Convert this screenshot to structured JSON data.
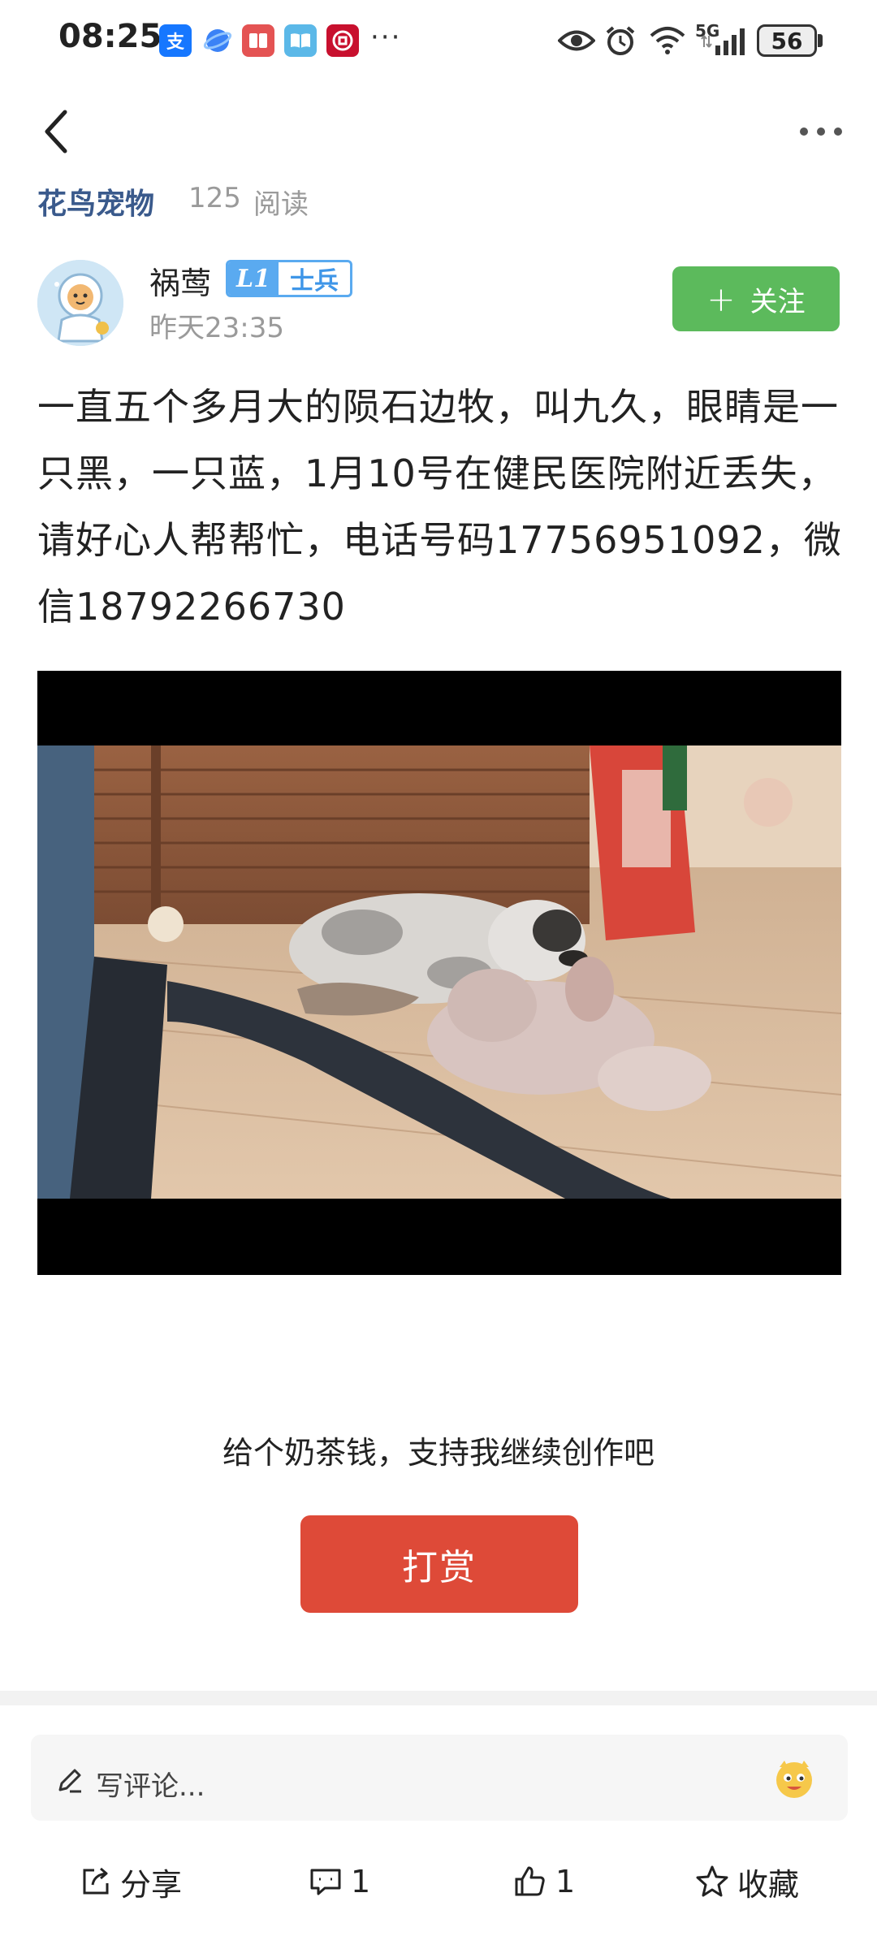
{
  "status_bar": {
    "time": "08:25",
    "network": "5G",
    "battery": "56",
    "overflow": "···",
    "app_icons": [
      "alipay-icon",
      "browser-icon",
      "reader-icon",
      "book-icon",
      "bank-icon"
    ]
  },
  "post": {
    "category": "花鸟宠物",
    "read_count": "125",
    "read_unit": "阅读",
    "author": {
      "name": "祸莺",
      "level": "L1",
      "rank": "士兵",
      "time": "昨天23:35"
    },
    "follow_label": "关注",
    "body": "一直五个多月大的陨石边牧，叫九久，眼睛是一只黑，一只蓝，1月10号在健民医院附近丢失，请好心人帮帮忙，电话号码17756951092，微信18792266730"
  },
  "reward": {
    "prompt": "给个奶茶钱，支持我继续创作吧",
    "button": "打赏"
  },
  "bottom_bar": {
    "comment_placeholder": "写评论...",
    "share_label": "分享",
    "comment_count": "1",
    "like_count": "1",
    "favorite_label": "收藏"
  },
  "colors": {
    "follow_green": "#5cba5c",
    "reward_red": "#de4a38",
    "category_blue": "#3a5a8c",
    "badge_blue": "#5aaaf0"
  }
}
